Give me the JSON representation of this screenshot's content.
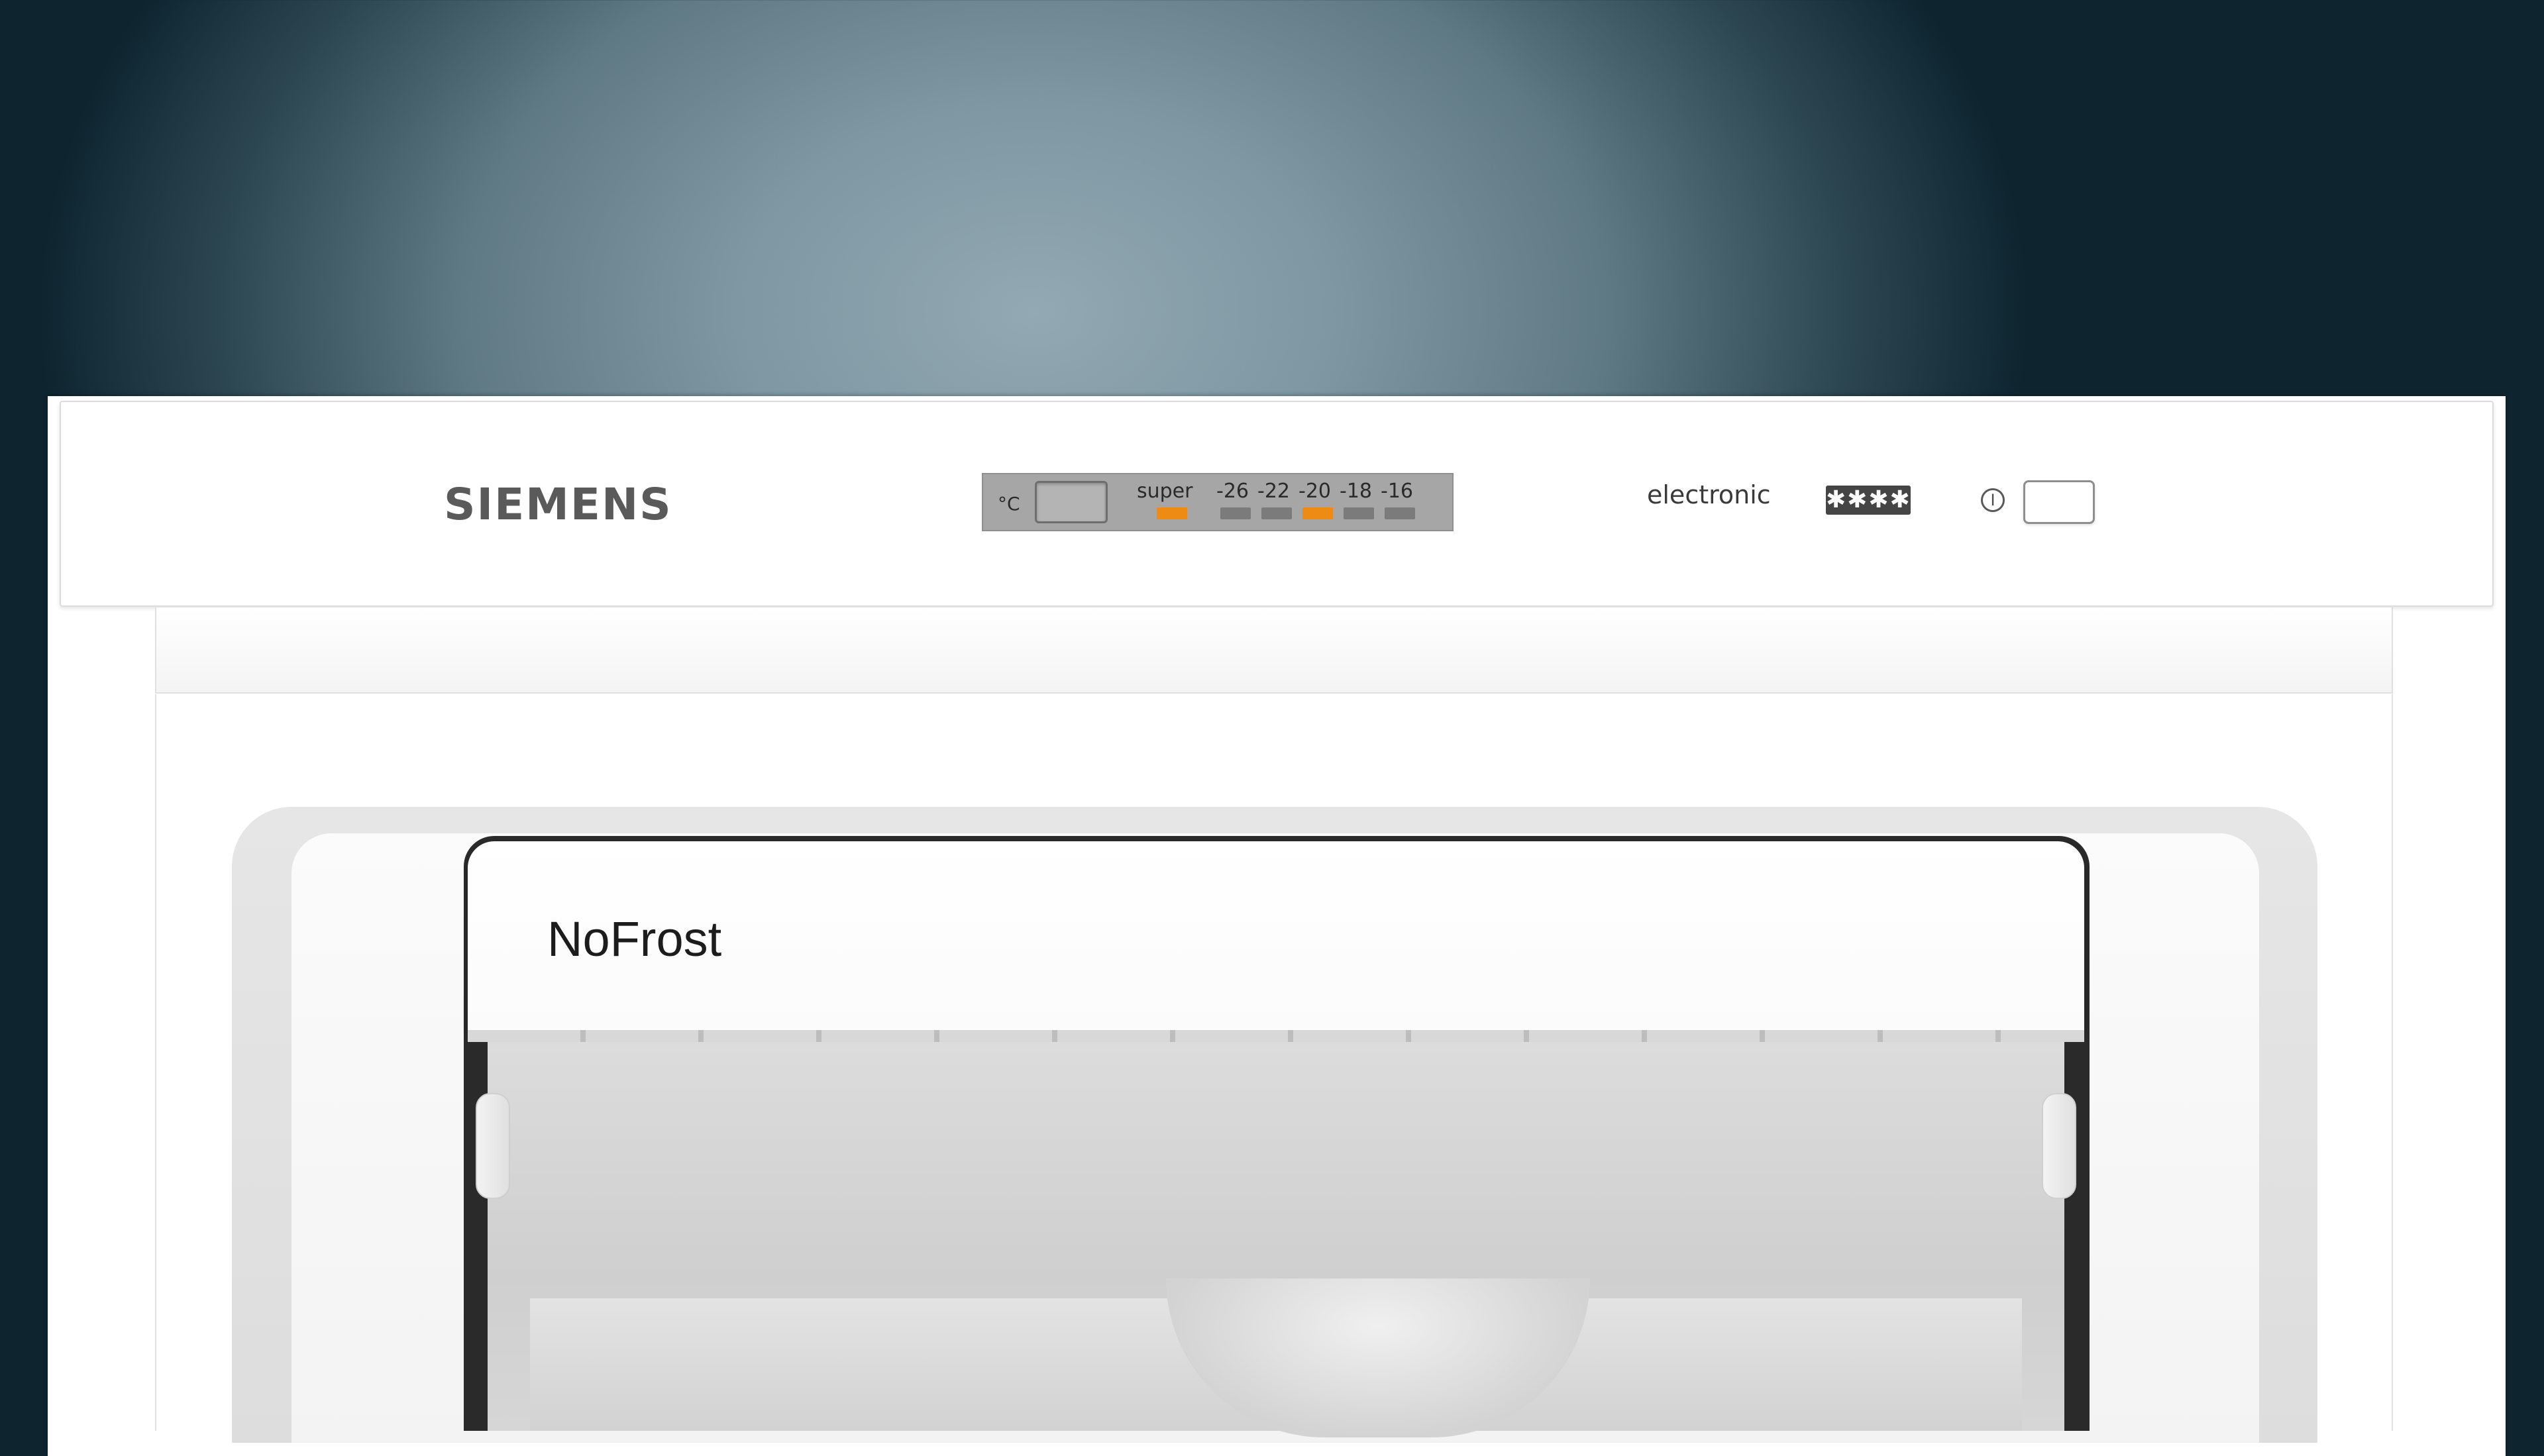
{
  "control_panel": {
    "brand": "SIEMENS",
    "display": {
      "unit": "°C",
      "super_label": "super",
      "super_active": true,
      "temperatures": [
        "-26",
        "-22",
        "-20",
        "-18",
        "-16"
      ],
      "selected_temperature": "-20"
    },
    "mode_label": "electronic",
    "freezer_rating": "✱✱✱✱"
  },
  "drawer": {
    "label": "NoFrost"
  },
  "colors": {
    "led_on": "#ee8b15",
    "led_off": "#7b7b7b",
    "display_background": "#a6a6a6"
  }
}
